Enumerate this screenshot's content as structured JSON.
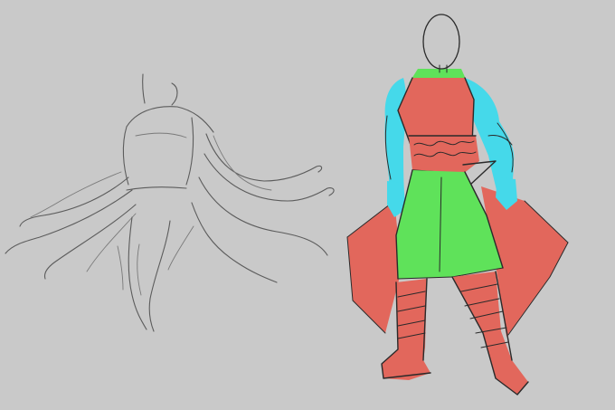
{
  "canvas": {
    "background": "#c9c9c9"
  },
  "palette": {
    "cape_red": "#e2675c",
    "tunic_red": "#e2675c",
    "skirt_green": "#5fe25a",
    "collar_green": "#5fe25a",
    "arm_cyan": "#45d9ea",
    "line_dark": "#2a2a2a",
    "pencil_grey": "#5c5c5c",
    "head_fill": "#c9c9c9"
  }
}
